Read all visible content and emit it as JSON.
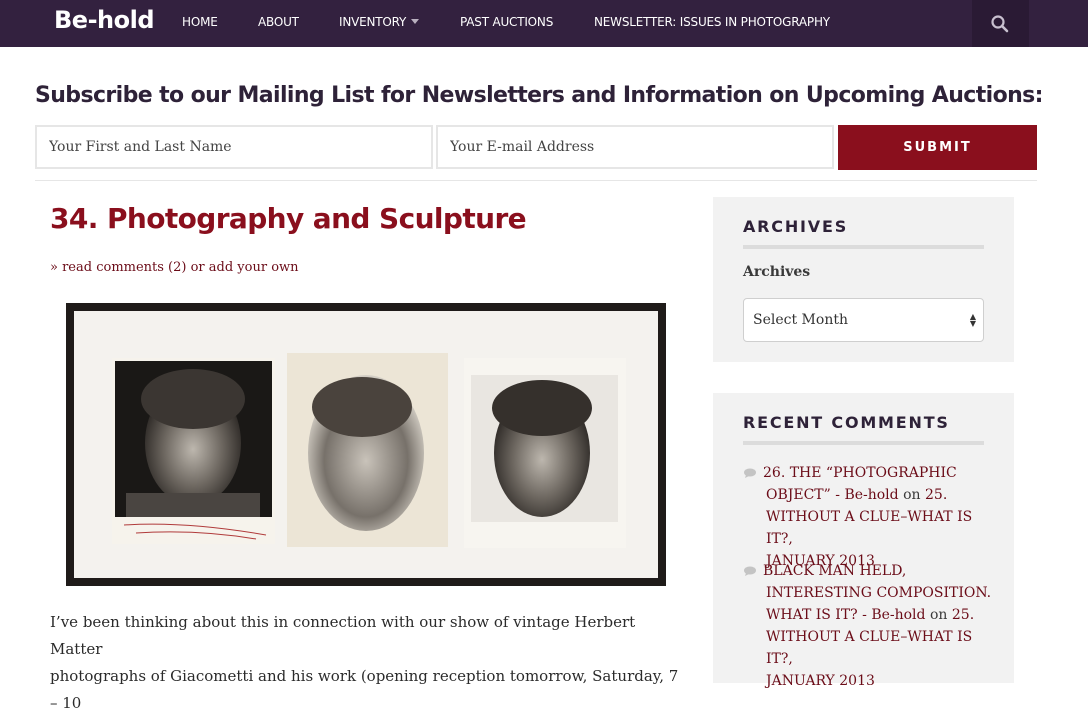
{
  "navbar": {
    "logo": "Be-hold",
    "items": [
      {
        "label": "HOME"
      },
      {
        "label": "ABOUT"
      },
      {
        "label": "INVENTORY"
      },
      {
        "label": "PAST AUCTIONS"
      },
      {
        "label": "NEWSLETTER: ISSUES IN PHOTOGRAPHY"
      }
    ],
    "search_icon": "search-icon"
  },
  "subscribe": {
    "title": "Subscribe to our Mailing List for Newsletters and Information on Upcoming Auctions:",
    "name_placeholder": "Your First and Last Name",
    "email_placeholder": "Your E-mail Address",
    "submit_label": "SUBMIT"
  },
  "post": {
    "title": "34. Photography and Sculpture",
    "meta_prefix": "» ",
    "meta_link": "read comments (2) or add your own",
    "body_lines": [
      "I’ve been thinking about this in connection with our show of vintage Herbert Matter",
      "photographs of Giacometti and his work (opening reception tomorrow, Saturday, 7 – 10"
    ]
  },
  "sidebar": {
    "archives": {
      "title": "ARCHIVES",
      "label": "Archives",
      "select_value": "Select Month"
    },
    "recent_comments": {
      "title": "RECENT COMMENTS",
      "items": [
        {
          "lines": [
            "26. THE “PHOTOGRAPHIC",
            "OBJECT” - ",
            "WITHOUT A CLUE–WHAT IS IT?,",
            "JANUARY 2013"
          ],
          "author": "Be-hold",
          "on": " on ",
          "post_start": "25."
        },
        {
          "lines": [
            "BLACK MAN HELD,",
            "INTERESTING COMPOSITION.",
            "WHAT IS IT? - ",
            "WITHOUT A CLUE–WHAT IS IT?,",
            "JANUARY 2013"
          ],
          "author": "Be-hold",
          "on": " on ",
          "post_start": "25."
        }
      ]
    }
  },
  "colors": {
    "nav_bg": "#33213f",
    "accent": "#8a0f1d",
    "heading": "#2e2238",
    "widget_bg": "#f2f2f2"
  }
}
